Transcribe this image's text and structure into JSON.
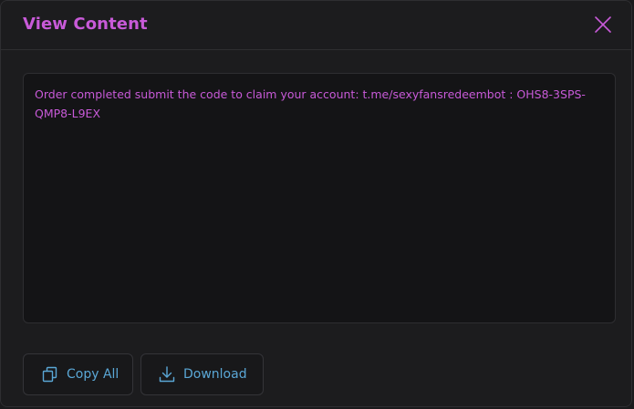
{
  "dialog": {
    "title": "View Content",
    "content": "Order completed submit the code to claim your account: t.me/sexyfansredeembot : OHS8-3SPS-QMP8-L9EX"
  },
  "actions": {
    "copy_label": "Copy All",
    "download_label": "Download"
  },
  "icons": {
    "close": "close-icon",
    "copy": "copy-icon",
    "download": "download-icon"
  },
  "colors": {
    "accent": "#c85ad8",
    "button_text": "#5aa7d6"
  }
}
